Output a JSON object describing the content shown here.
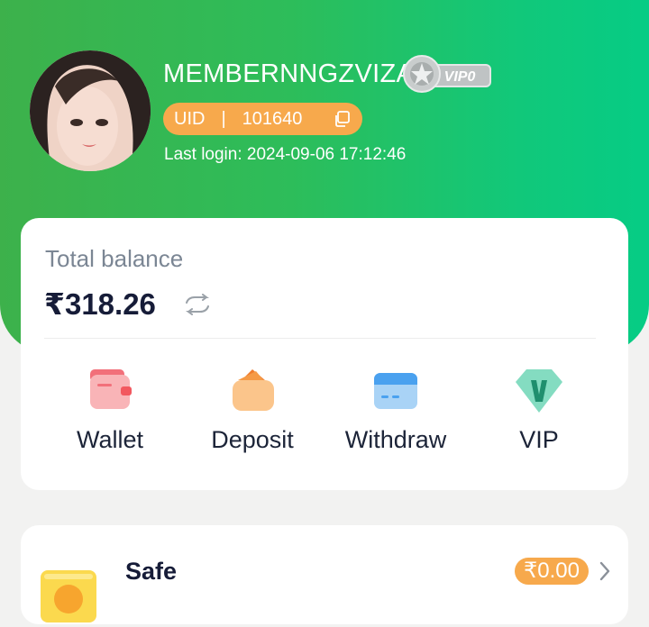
{
  "profile": {
    "username": "MEMBERNNGZVIZA",
    "vip_badge": "VIP0",
    "uid_label": "UID",
    "uid_separator": "|",
    "uid_value": "101640",
    "last_login": "Last login: 2024-09-06 17:12:46"
  },
  "balance": {
    "label": "Total balance",
    "amount": "₹318.26"
  },
  "actions": [
    {
      "label": "Wallet",
      "icon": "wallet-icon"
    },
    {
      "label": "Deposit",
      "icon": "deposit-icon"
    },
    {
      "label": "Withdraw",
      "icon": "withdraw-icon"
    },
    {
      "label": "VIP",
      "icon": "vip-icon"
    }
  ],
  "safe": {
    "title": "Safe",
    "amount": "₹0.00"
  },
  "colors": {
    "header_gradient_start": "#3db14b",
    "header_gradient_end": "#06cc85",
    "accent_orange": "#f7a94c",
    "text_dark": "#161c38"
  }
}
